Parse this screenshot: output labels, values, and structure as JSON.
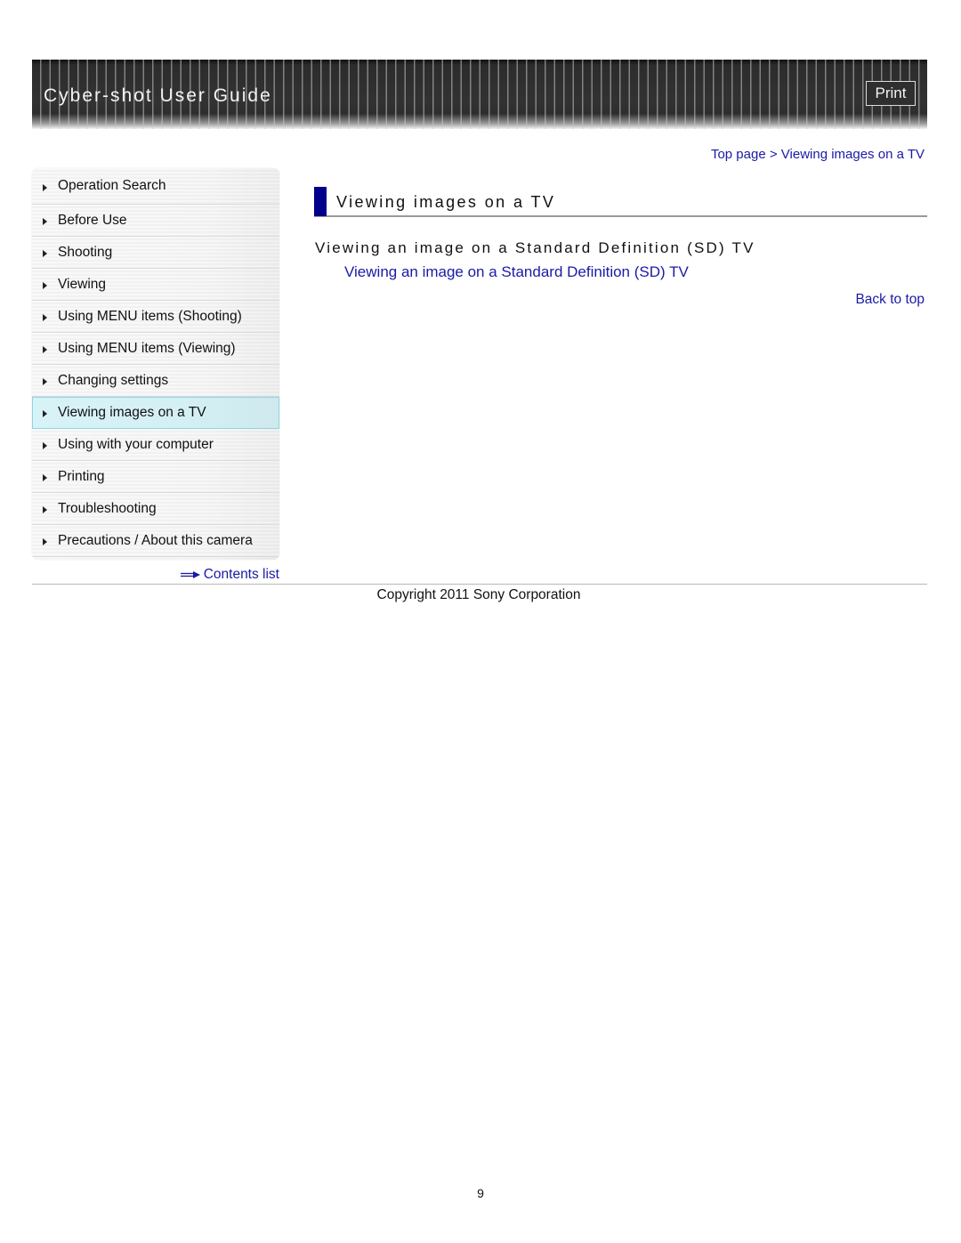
{
  "header": {
    "title": "Cyber-shot User Guide",
    "print_label": "Print"
  },
  "breadcrumb": {
    "items": [
      "Top page",
      "Viewing images on a TV"
    ],
    "separator": " > "
  },
  "sidebar": {
    "items": [
      {
        "label": "Operation Search",
        "active": false
      },
      {
        "label": "Before Use",
        "active": false
      },
      {
        "label": "Shooting",
        "active": false
      },
      {
        "label": "Viewing",
        "active": false
      },
      {
        "label": "Using MENU items (Shooting)",
        "active": false
      },
      {
        "label": "Using MENU items (Viewing)",
        "active": false
      },
      {
        "label": "Changing settings",
        "active": false
      },
      {
        "label": "Viewing images on a TV",
        "active": true
      },
      {
        "label": "Using with your computer",
        "active": false
      },
      {
        "label": "Printing",
        "active": false
      },
      {
        "label": "Troubleshooting",
        "active": false
      },
      {
        "label": "Precautions / About this camera",
        "active": false
      }
    ],
    "contents_link": "Contents list"
  },
  "main": {
    "title": "Viewing images on a TV",
    "section_heading": "Viewing an image on a Standard Definition (SD) TV",
    "section_link": "Viewing an image on a Standard Definition (SD) TV",
    "back_to_top": "Back to top"
  },
  "footer": {
    "copyright": "Copyright 2011 Sony Corporation",
    "page_number": "9"
  },
  "colors": {
    "link": "#1a1aa6",
    "title_bar_accent": "#00008b",
    "active_nav": "#d8f3f7"
  }
}
